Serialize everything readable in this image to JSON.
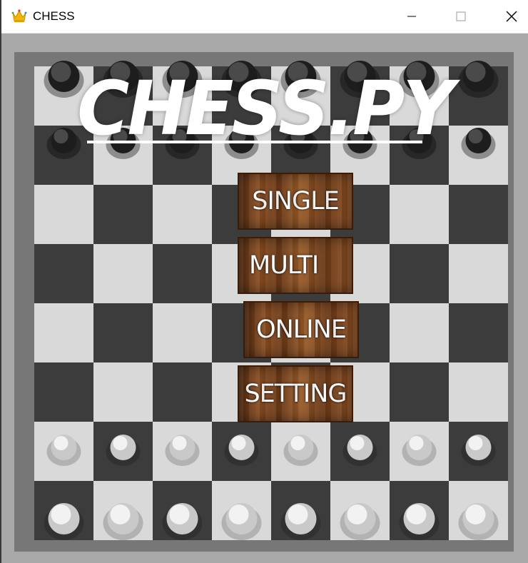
{
  "window": {
    "title": "CHESS",
    "app_icon": "crown-icon",
    "controls": [
      "minimize-icon",
      "maximize-icon",
      "close-icon"
    ]
  },
  "game": {
    "title": "CHESS.PY",
    "menu": {
      "single_label": "SINGLE",
      "multi_label": "MULTI",
      "online_label": "ONLINE",
      "setting_label": "SETTING"
    }
  },
  "colors": {
    "board_dark": "#3c3c3c",
    "board_light": "#d9d9d9",
    "frame": "#a8a8a8",
    "button_wood": "#7a4420"
  }
}
